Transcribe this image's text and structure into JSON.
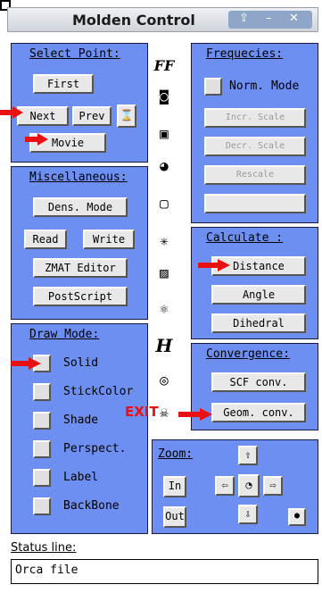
{
  "window": {
    "title": "Molden Control"
  },
  "select_point": {
    "header": "Select Point:",
    "first": "First",
    "next": "Next",
    "prev": "Prev",
    "movie": "Movie"
  },
  "frequencies": {
    "header": "Frequecies:",
    "norm_mode": "Norm. Mode",
    "scale1": "Incr. Scale",
    "scale2": "Decr. Scale",
    "rescale": "Rescale",
    "blank": ""
  },
  "misc": {
    "header": "Miscellaneous:",
    "dens_mode": "Dens. Mode",
    "read": "Read",
    "write": "Write",
    "zmat": "ZMAT Editor",
    "postscript": "PostScript"
  },
  "calculate": {
    "header": "Calculate :",
    "distance": "Distance",
    "angle": "Angle",
    "dihedral": "Dihedral"
  },
  "draw_mode": {
    "header": "Draw Mode:",
    "items": [
      "Solid",
      "StickColor",
      "Shade",
      "Perspect.",
      "Label",
      "BackBone"
    ]
  },
  "convergence": {
    "header": "Convergence:",
    "scf": "SCF conv.",
    "geom": "Geom. conv."
  },
  "zoom": {
    "header": "Zoom:",
    "in": "In",
    "out": "Out"
  },
  "toolbar": {
    "ff": "FF",
    "h": "H",
    "exit": "EXIT"
  },
  "status": {
    "header": "Status line:",
    "text": "Orca file"
  },
  "colors": {
    "panel": "#6d8ff2",
    "arrow": "#e81010"
  }
}
